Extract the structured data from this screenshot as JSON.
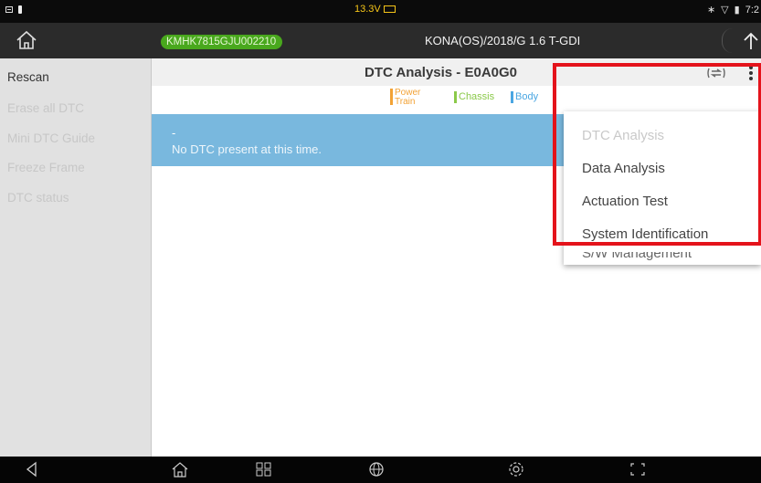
{
  "status_bar": {
    "voltage": "13.3V",
    "time": "7:2"
  },
  "app_bar": {
    "vin": "KMHK7815GJU002210",
    "vehicle": "KONA(OS)/2018/G 1.6 T-GDI"
  },
  "sidebar": {
    "items": [
      {
        "label": "Rescan",
        "enabled": true
      },
      {
        "label": "Erase all DTC",
        "enabled": false
      },
      {
        "label": "Mini DTC Guide",
        "enabled": false
      },
      {
        "label": "Freeze Frame",
        "enabled": false
      },
      {
        "label": "DTC status",
        "enabled": false
      }
    ]
  },
  "main": {
    "title": "DTC Analysis - E0A0G0",
    "legend": [
      {
        "label": "Power",
        "label2": "Train",
        "color": "#f2a235"
      },
      {
        "label": "Chassis",
        "color": "#8bc94a"
      },
      {
        "label": "Body",
        "color": "#4aa6e2"
      }
    ],
    "dtc_row": {
      "code": "-",
      "message": "No DTC present at this time."
    }
  },
  "menu": {
    "items": [
      {
        "label": "DTC Analysis",
        "enabled": false
      },
      {
        "label": "Data Analysis",
        "enabled": true
      },
      {
        "label": "Actuation Test",
        "enabled": true
      },
      {
        "label": "System Identification",
        "enabled": true
      },
      {
        "label": "S/W Management",
        "enabled": true
      }
    ]
  },
  "colors": {
    "highlight": "#e4131b",
    "vin_badge": "#49a81d",
    "dtc_row": "#79b8de"
  },
  "nav_icons": [
    "back-icon",
    "home-icon",
    "apps-icon",
    "browser-icon",
    "settings-icon",
    "screenshot-icon"
  ]
}
